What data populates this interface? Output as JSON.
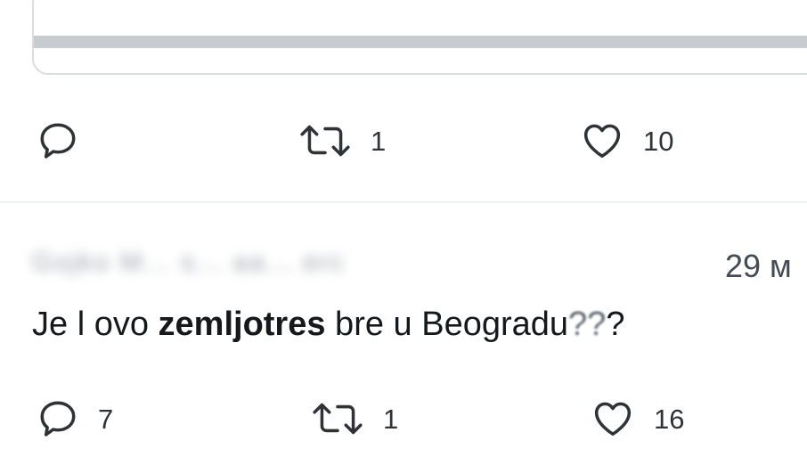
{
  "first_tweet": {
    "actions": {
      "reply_count": "",
      "retweet_count": "1",
      "like_count": "10"
    },
    "icons": {
      "reply": "reply-bubble-icon",
      "retweet": "retweet-icon",
      "like": "heart-icon"
    }
  },
  "second_tweet": {
    "author_blurred": "Gojko M... s... aa... erc",
    "timestamp": "29 м",
    "text": {
      "pre": "Je l ovo ",
      "highlight": "zemljotres",
      "post_faded_1": "",
      "mid": " bre u Beogradu",
      "faded_end": "??",
      "end": "?"
    },
    "actions": {
      "reply_count": "7",
      "retweet_count": "1",
      "like_count": "16"
    },
    "icons": {
      "reply": "reply-bubble-icon",
      "retweet": "retweet-icon",
      "like": "heart-icon"
    }
  },
  "colors": {
    "icon_stroke": "#2f3336",
    "divider": "#eff3f4",
    "card_border": "#d9dde1"
  }
}
